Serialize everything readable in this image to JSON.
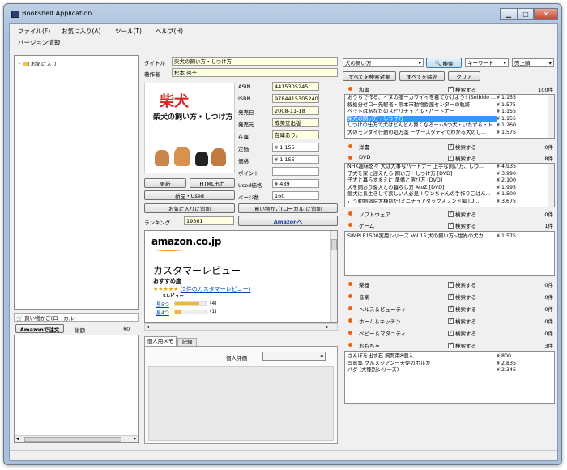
{
  "window": {
    "title": "Bookshelf Application"
  },
  "menubar": {
    "file": "ファイル(F)",
    "favorites": "お気に入り(A)",
    "tools": "ツール(T)",
    "help": "ヘルプ(H)",
    "version": "バージョン情報"
  },
  "tree": {
    "favorites": "お気に入り"
  },
  "cart": {
    "label": "買い物かご(ローカル)",
    "order_button": "Amazonで注文",
    "total_label": "総額",
    "total_value": "¥0"
  },
  "details": {
    "title_label": "タイトル",
    "title_value": "柴犬の飼い方・しつけ方",
    "author_label": "著作者",
    "author_value": "松本 啓子",
    "asin_label": "ASIN",
    "asin_value": "4415305245",
    "isbn_label": "ISBN",
    "isbn_value": "9784415305240",
    "date_label": "発売日",
    "date_value": "2008-11-18",
    "publisher_label": "発売元",
    "publisher_value": "成美堂出版",
    "stock_label": "在庫",
    "stock_value": "在庫あり。",
    "list_price_label": "定価",
    "list_price_value": "¥ 1,155",
    "price_label": "価格",
    "price_value": "¥ 1,155",
    "point_label": "ポイント",
    "point_value": "",
    "used_label": "Used価格",
    "used_value": "¥ 489",
    "pages_label": "ページ数",
    "pages_value": "160",
    "ranking_label": "ランキング",
    "ranking_value": "19361",
    "cover_title": "柴犬の飼い方・しつけ方"
  },
  "buttons": {
    "update": "更新",
    "html_output": "HTML出力",
    "new_used": "新品・Used",
    "add_favorite": "お気に入りに追加",
    "add_cart": "買い物かご(ローカル)に追加",
    "amazon": "Amazonへ"
  },
  "review": {
    "logo": "amazon.co.jp",
    "heading": "カスタマーレビュー",
    "recommend": "おすすめ度",
    "stars": "★★★★★",
    "count_link": "(5件のカスタマーレビュー)",
    "review_word": "5レビュー",
    "star5_label": "星5つ",
    "star5_count": "(4)",
    "star5_ratio": 0.8,
    "star4_label": "星4つ",
    "star4_count": "(1)",
    "star4_ratio": 0.2
  },
  "memo": {
    "tab_personal": "個人用メモ",
    "tab_record": "記録",
    "rating_label": "個人評価"
  },
  "search": {
    "query": "犬の飼い方",
    "button": "検索",
    "mode": "キーワード",
    "sort": "売上順",
    "all_targets": "すべてを検索対象",
    "all_exclude": "すべてを除外",
    "clear": "クリア"
  },
  "checkbox_label": "検索する",
  "categories": {
    "books_jp": {
      "name": "和書",
      "count": "100件"
    },
    "books_en": {
      "name": "洋書",
      "count": "0件"
    },
    "dvd": {
      "name": "DVD",
      "count": "8件"
    },
    "software": {
      "name": "ソフトウェア",
      "count": "0件"
    },
    "games": {
      "name": "ゲーム",
      "count": "1件"
    },
    "instruments": {
      "name": "楽器",
      "count": "0件"
    },
    "music": {
      "name": "音楽",
      "count": "0件"
    },
    "health": {
      "name": "ヘルス＆ビューティ",
      "count": "0件"
    },
    "home": {
      "name": "ホーム＆キッチン",
      "count": "0件"
    },
    "baby": {
      "name": "ベビー＆マタニティ",
      "count": "0件"
    },
    "toys": {
      "name": "おもちゃ",
      "count": "3件"
    }
  },
  "books_list": [
    {
      "t": "おうちで作る、イヌの服ーカワイイを着てかけよう! (Seibido ...",
      "p": "¥ 1,155"
    },
    {
      "t": "殺処分ゼロー先駆者・熊本市動物愛護センターの軌跡",
      "p": "¥ 1,575"
    },
    {
      "t": "ペットはあなたのスピリチュアル・パートナー",
      "p": "¥ 1,155"
    },
    {
      "t": "柴犬の飼い方・しつけ方",
      "p": "¥ 1,155"
    },
    {
      "t": "しつけの仕方で犬はどんどん賢くなるーム9つ犬・いたずら・ト...",
      "p": "¥ 1,260"
    },
    {
      "t": "犬のモンダイ行動の処方箋 ーケースタディでわかる犬のし...",
      "p": "¥ 1,575"
    }
  ],
  "dvd_list": [
    {
      "t": "NHK趣味悠々 犬は大事なパートナー 上手な飼い方、しつ...",
      "p": "¥ 4,935"
    },
    {
      "t": "子犬を家に迎えたら 飼い方・しつけ方 [DVD]",
      "p": "¥ 3,990"
    },
    {
      "t": "子犬と暮らすまえに 準備と選び方 [DVD]",
      "p": "¥ 2,100"
    },
    {
      "t": "犬を飼おう愛犬との暮らし方 AtoZ [DVD]",
      "p": "¥ 1,995"
    },
    {
      "t": "愛犬に長生きして欲しい人必見!! ワンちゃんの手作りごはん...",
      "p": "¥ 1,500"
    },
    {
      "t": "ごう動物病院犬種別だ!ミニチュアダックスフンド編 [D...",
      "p": "¥ 3,675"
    }
  ],
  "game_list": [
    {
      "t": "SIMPLE1500実用シリーズ Vol.15 犬の飼い方~世界の犬カ...",
      "p": "¥ 1,575"
    }
  ],
  "toys_list": [
    {
      "t": "さんぽを出す石 飼育用8個入",
      "p": "¥ 800"
    },
    {
      "t": "写真集 グルメジアンー天使のポルカ",
      "p": "¥ 2,835"
    },
    {
      "t": "パグ (犬種別シリーズ)",
      "p": "¥ 2,345"
    }
  ]
}
